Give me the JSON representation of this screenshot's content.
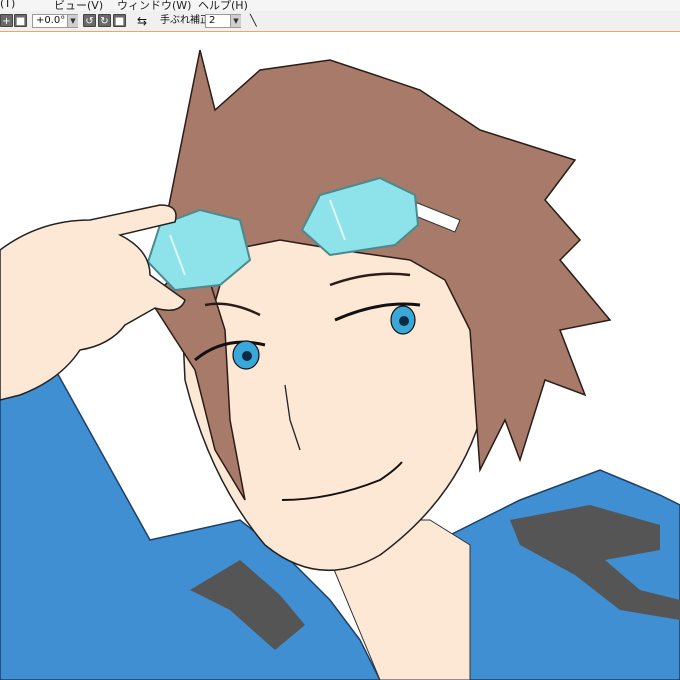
{
  "menubar": {
    "items": [
      "(T)",
      "ビュー(V)",
      "ウィンドウ(W)",
      "ヘルプ(H)"
    ]
  },
  "toolbar": {
    "add_icon": "plus-icon",
    "square_icon": "square-icon",
    "rotation_value": "+0.0°",
    "rotate_left_icon": "rotate-left-icon",
    "rotate_right_icon": "rotate-right-icon",
    "reset_icon": "square-icon",
    "flip_icon": "flip-horizontal-icon",
    "stabilizer_label": "手ぶれ補正",
    "stabilizer_value": "2",
    "line_tool_icon": "line-tool-icon"
  },
  "colors": {
    "hair": "#a87a69",
    "skin": "#fde7d5",
    "jacket": "#3f8fd2",
    "jacket_stripe": "#555555",
    "goggles": "#8ee3ea",
    "accent_border": "#e8a86a"
  }
}
